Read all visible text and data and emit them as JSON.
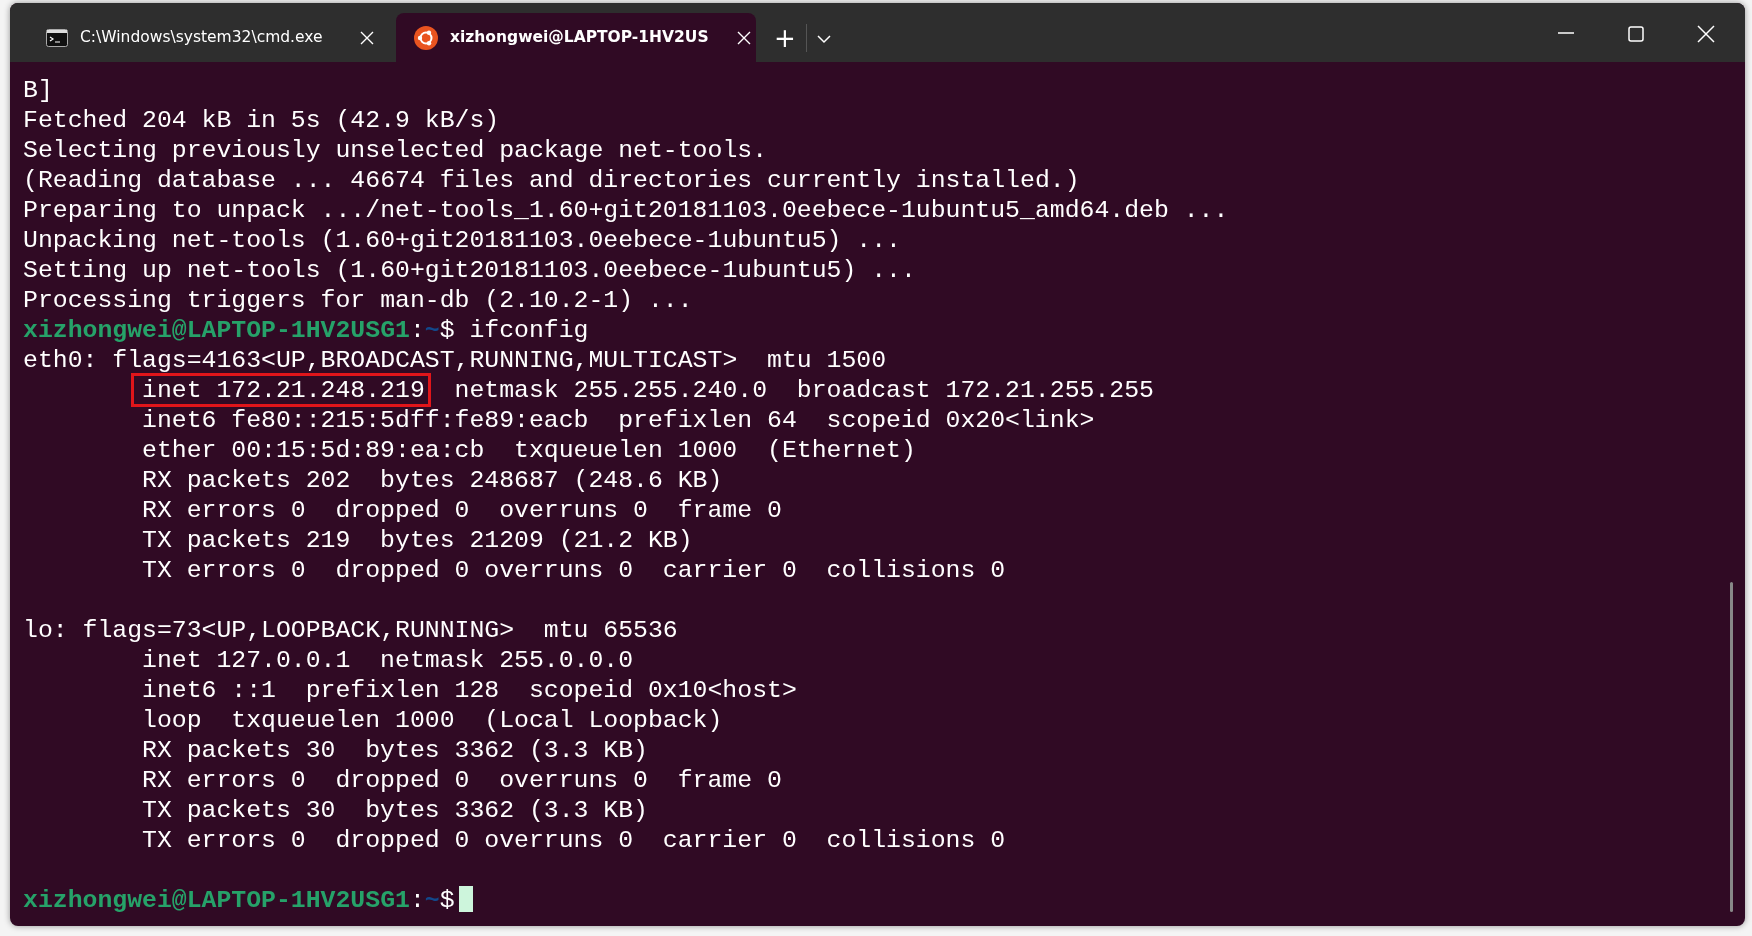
{
  "tabs": [
    {
      "title": "C:\\Windows\\system32\\cmd.exe",
      "kind": "cmd",
      "selected": false
    },
    {
      "title": "xizhongwei@LAPTOP-1HV2US",
      "kind": "ubuntu",
      "selected": true
    }
  ],
  "tab_actions": {
    "new_tab": "+"
  },
  "terminal": {
    "lines": [
      {
        "kind": "output",
        "indent": false,
        "segments": [
          {
            "text": "B]"
          }
        ]
      },
      {
        "kind": "output",
        "indent": false,
        "segments": [
          {
            "text": "Fetched 204 kB in 5s (42.9 kB/s)"
          }
        ]
      },
      {
        "kind": "output",
        "indent": false,
        "segments": [
          {
            "text": "Selecting previously unselected package net-tools."
          }
        ]
      },
      {
        "kind": "output",
        "indent": false,
        "segments": [
          {
            "text": "(Reading database ... 46674 files and directories currently installed.)"
          }
        ]
      },
      {
        "kind": "output",
        "indent": false,
        "segments": [
          {
            "text": "Preparing to unpack .../net-tools_1.60+git20181103.0eebece-1ubuntu5_amd64.deb ..."
          }
        ]
      },
      {
        "kind": "output",
        "indent": false,
        "segments": [
          {
            "text": "Unpacking net-tools (1.60+git20181103.0eebece-1ubuntu5) ..."
          }
        ]
      },
      {
        "kind": "output",
        "indent": false,
        "segments": [
          {
            "text": "Setting up net-tools (1.60+git20181103.0eebece-1ubuntu5) ..."
          }
        ]
      },
      {
        "kind": "output",
        "indent": false,
        "segments": [
          {
            "text": "Processing triggers for man-db (2.10.2-1) ..."
          }
        ]
      },
      {
        "kind": "prompt",
        "user_host": "xizhongwei@LAPTOP-1HV2USG1",
        "separator": ":",
        "path": "~",
        "sign": "$",
        "command": " ifconfig"
      },
      {
        "kind": "output",
        "indent": false,
        "segments": [
          {
            "text": "eth0: flags=4163<UP,BROADCAST,RUNNING,MULTICAST>  mtu 1500"
          }
        ]
      },
      {
        "kind": "output",
        "indent": true,
        "segments": [
          {
            "text": "inet 172.21.248.219",
            "boxed": true
          },
          {
            "text": "  netmask 255.255.240.0  broadcast 172.21.255.255"
          }
        ]
      },
      {
        "kind": "output",
        "indent": true,
        "segments": [
          {
            "text": "inet6 fe80::215:5dff:fe89:eacb  prefixlen 64  scopeid 0x20<link>"
          }
        ]
      },
      {
        "kind": "output",
        "indent": true,
        "segments": [
          {
            "text": "ether 00:15:5d:89:ea:cb  txqueuelen 1000  (Ethernet)"
          }
        ]
      },
      {
        "kind": "output",
        "indent": true,
        "segments": [
          {
            "text": "RX packets 202  bytes 248687 (248.6 KB)"
          }
        ]
      },
      {
        "kind": "output",
        "indent": true,
        "segments": [
          {
            "text": "RX errors 0  dropped 0  overruns 0  frame 0"
          }
        ]
      },
      {
        "kind": "output",
        "indent": true,
        "segments": [
          {
            "text": "TX packets 219  bytes 21209 (21.2 KB)"
          }
        ]
      },
      {
        "kind": "output",
        "indent": true,
        "segments": [
          {
            "text": "TX errors 0  dropped 0 overruns 0  carrier 0  collisions 0"
          }
        ]
      },
      {
        "kind": "blank"
      },
      {
        "kind": "output",
        "indent": false,
        "segments": [
          {
            "text": "lo: flags=73<UP,LOOPBACK,RUNNING>  mtu 65536"
          }
        ]
      },
      {
        "kind": "output",
        "indent": true,
        "segments": [
          {
            "text": "inet 127.0.0.1  netmask 255.0.0.0"
          }
        ]
      },
      {
        "kind": "output",
        "indent": true,
        "segments": [
          {
            "text": "inet6 ::1  prefixlen 128  scopeid 0x10<host>"
          }
        ]
      },
      {
        "kind": "output",
        "indent": true,
        "segments": [
          {
            "text": "loop  txqueuelen 1000  (Local Loopback)"
          }
        ]
      },
      {
        "kind": "output",
        "indent": true,
        "segments": [
          {
            "text": "RX packets 30  bytes 3362 (3.3 KB)"
          }
        ]
      },
      {
        "kind": "output",
        "indent": true,
        "segments": [
          {
            "text": "RX errors 0  dropped 0  overruns 0  frame 0"
          }
        ]
      },
      {
        "kind": "output",
        "indent": true,
        "segments": [
          {
            "text": "TX packets 30  bytes 3362 (3.3 KB)"
          }
        ]
      },
      {
        "kind": "output",
        "indent": true,
        "segments": [
          {
            "text": "TX errors 0  dropped 0 overruns 0  carrier 0  collisions 0"
          }
        ]
      },
      {
        "kind": "blank"
      },
      {
        "kind": "prompt",
        "user_host": "xizhongwei@LAPTOP-1HV2USG1",
        "separator": ":",
        "path": "~",
        "sign": "$",
        "cursor": true
      }
    ]
  }
}
